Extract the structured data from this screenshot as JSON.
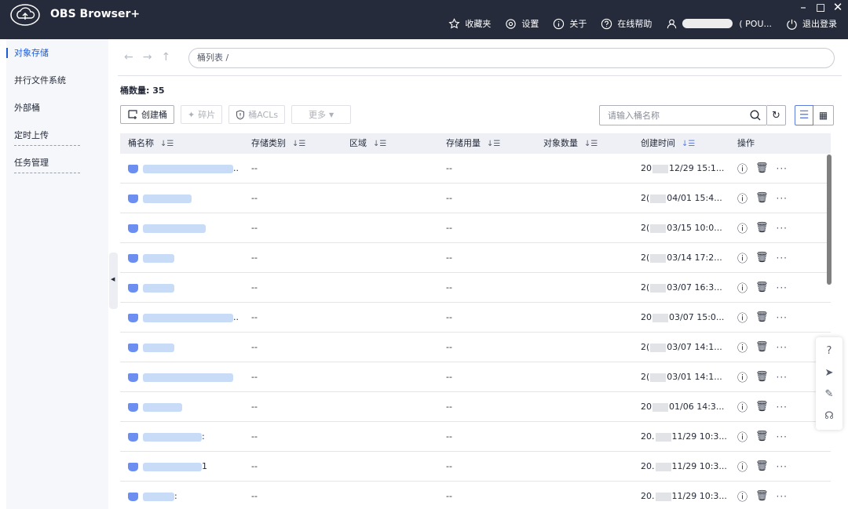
{
  "app": {
    "title": "OBS Browser+",
    "window_controls": {
      "minimize": "–",
      "maximize": "◻",
      "close": "✕"
    }
  },
  "top_nav": {
    "favorites": "收藏夹",
    "settings": "设置",
    "about": "关于",
    "help": "在线帮助",
    "user": "( POU...",
    "logout": "退出登录"
  },
  "sidebar": {
    "items": [
      {
        "label": "对象存储",
        "active": true
      },
      {
        "label": "并行文件系统"
      },
      {
        "label": "外部桶"
      },
      {
        "label": "定时上传"
      },
      {
        "label": "任务管理"
      }
    ]
  },
  "breadcrumb": {
    "path": "桶列表 /"
  },
  "bucket_count": {
    "label": "桶数量:",
    "value": "35"
  },
  "toolbar": {
    "create_bucket": "创建桶",
    "fragments": "碎片",
    "bucket_acls": "桶ACLs",
    "more": "更多"
  },
  "search": {
    "placeholder": "请输入桶名称",
    "value": ""
  },
  "table": {
    "headers": {
      "name": "桶名称",
      "storage_class": "存储类别",
      "region": "区域",
      "storage_usage": "存储用量",
      "object_count": "对象数量",
      "created": "创建时间",
      "ops": "操作"
    },
    "rows": [
      {
        "name_suffix": "..",
        "storage_class": "--",
        "storage_usage": "--",
        "time_prefix": "20",
        "time_suffix": "12/29 15:1..."
      },
      {
        "name_suffix": "",
        "storage_class": "--",
        "storage_usage": "--",
        "time_prefix": "2(",
        "time_suffix": "04/01 15:4..."
      },
      {
        "name_suffix": "",
        "storage_class": "--",
        "storage_usage": "--",
        "time_prefix": "2(",
        "time_suffix": "03/15 10:0..."
      },
      {
        "name_suffix": "",
        "storage_class": "--",
        "storage_usage": "--",
        "time_prefix": "2(",
        "time_suffix": "03/14 17:2..."
      },
      {
        "name_suffix": "",
        "storage_class": "--",
        "storage_usage": "--",
        "time_prefix": "2(",
        "time_suffix": "03/07 16:3..."
      },
      {
        "name_suffix": "..",
        "storage_class": "--",
        "storage_usage": "--",
        "time_prefix": "20",
        "time_suffix": "03/07 15:0..."
      },
      {
        "name_suffix": "",
        "storage_class": "--",
        "storage_usage": "--",
        "time_prefix": "2(",
        "time_suffix": "03/07 14:1..."
      },
      {
        "name_suffix": "",
        "storage_class": "--",
        "storage_usage": "--",
        "time_prefix": "2(",
        "time_suffix": "03/01 14:1..."
      },
      {
        "name_suffix": "",
        "storage_class": "--",
        "storage_usage": "--",
        "time_prefix": "20",
        "time_suffix": "01/06 14:3..."
      },
      {
        "name_suffix": ":",
        "storage_class": "--",
        "storage_usage": "--",
        "time_prefix": "20.",
        "time_suffix": "11/29 10:3..."
      },
      {
        "name_suffix": "1",
        "storage_class": "--",
        "storage_usage": "--",
        "time_prefix": "20.",
        "time_suffix": "11/29 10:3..."
      },
      {
        "name_suffix": ":",
        "storage_class": "--",
        "storage_usage": "--",
        "time_prefix": "20.",
        "time_suffix": "11/29 10:3..."
      }
    ]
  },
  "colors": {
    "titlebar": "#252b3a",
    "accent": "#5e7ce0",
    "sidebar_active": "#1a5bd6",
    "bucket_icon": "#6b8ef0"
  },
  "icons": [
    "cloud-logo-icon",
    "star-icon",
    "gear-icon",
    "info-icon",
    "help-icon",
    "user-icon",
    "power-icon",
    "back-arrow-icon",
    "forward-arrow-icon",
    "up-arrow-icon",
    "create-bucket-icon",
    "fragment-icon",
    "shield-icon",
    "search-icon",
    "refresh-icon",
    "list-view-icon",
    "grid-view-icon",
    "bucket-icon",
    "info-icon",
    "delete-icon",
    "more-icon",
    "question-icon",
    "send-icon",
    "edit-icon",
    "headset-icon"
  ]
}
